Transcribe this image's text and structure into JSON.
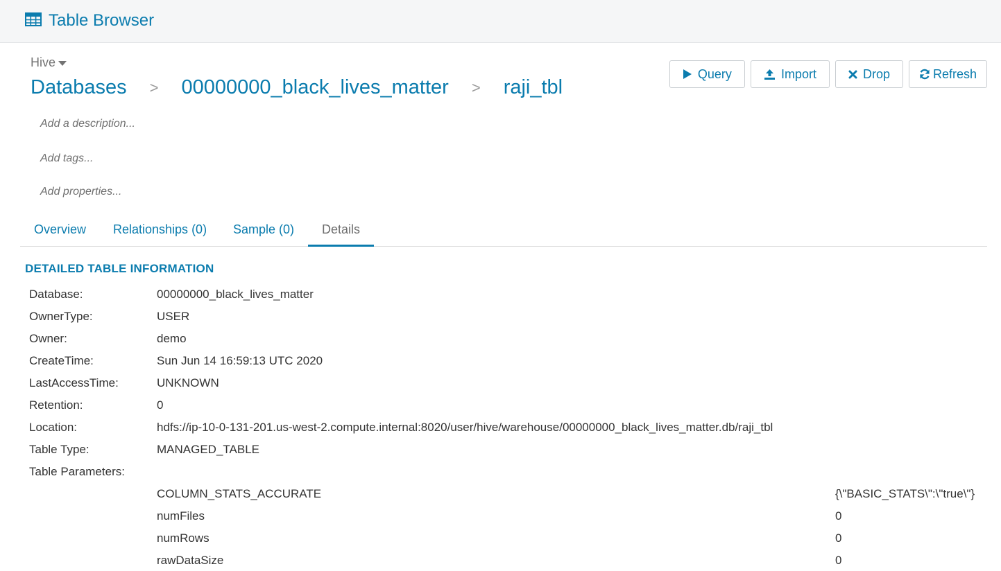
{
  "app": {
    "title": "Table Browser"
  },
  "source": {
    "selected": "Hive"
  },
  "breadcrumb": {
    "root": "Databases",
    "database": "00000000_black_lives_matter",
    "table": "raji_tbl",
    "separator": ">"
  },
  "actions": {
    "query": "Query",
    "import": "Import",
    "drop": "Drop",
    "refresh": "Refresh"
  },
  "meta": {
    "description": "Add a description...",
    "tags": "Add tags...",
    "properties": "Add properties..."
  },
  "tabs": [
    {
      "label": "Overview"
    },
    {
      "label": "Relationships (0)"
    },
    {
      "label": "Sample (0)"
    },
    {
      "label": "Details"
    }
  ],
  "details": {
    "section_title": "DETAILED TABLE INFORMATION",
    "rows": [
      {
        "key": "Database:",
        "value": "00000000_black_lives_matter"
      },
      {
        "key": "OwnerType:",
        "value": "USER"
      },
      {
        "key": "Owner:",
        "value": "demo"
      },
      {
        "key": "CreateTime:",
        "value": "Sun Jun 14 16:59:13 UTC 2020"
      },
      {
        "key": "LastAccessTime:",
        "value": "UNKNOWN"
      },
      {
        "key": "Retention:",
        "value": "0"
      },
      {
        "key": "Location:",
        "value": "hdfs://ip-10-0-131-201.us-west-2.compute.internal:8020/user/hive/warehouse/00000000_black_lives_matter.db/raji_tbl"
      },
      {
        "key": "Table Type:",
        "value": "MANAGED_TABLE"
      },
      {
        "key": "Table Parameters:",
        "value": ""
      }
    ],
    "parameters": [
      {
        "name": "COLUMN_STATS_ACCURATE",
        "value": "{\\\"BASIC_STATS\\\":\\\"true\\\"}"
      },
      {
        "name": "numFiles",
        "value": "0"
      },
      {
        "name": "numRows",
        "value": "0"
      },
      {
        "name": "rawDataSize",
        "value": "0"
      }
    ]
  },
  "colors": {
    "accent": "#0b7cae",
    "muted": "#6f6f6f"
  }
}
